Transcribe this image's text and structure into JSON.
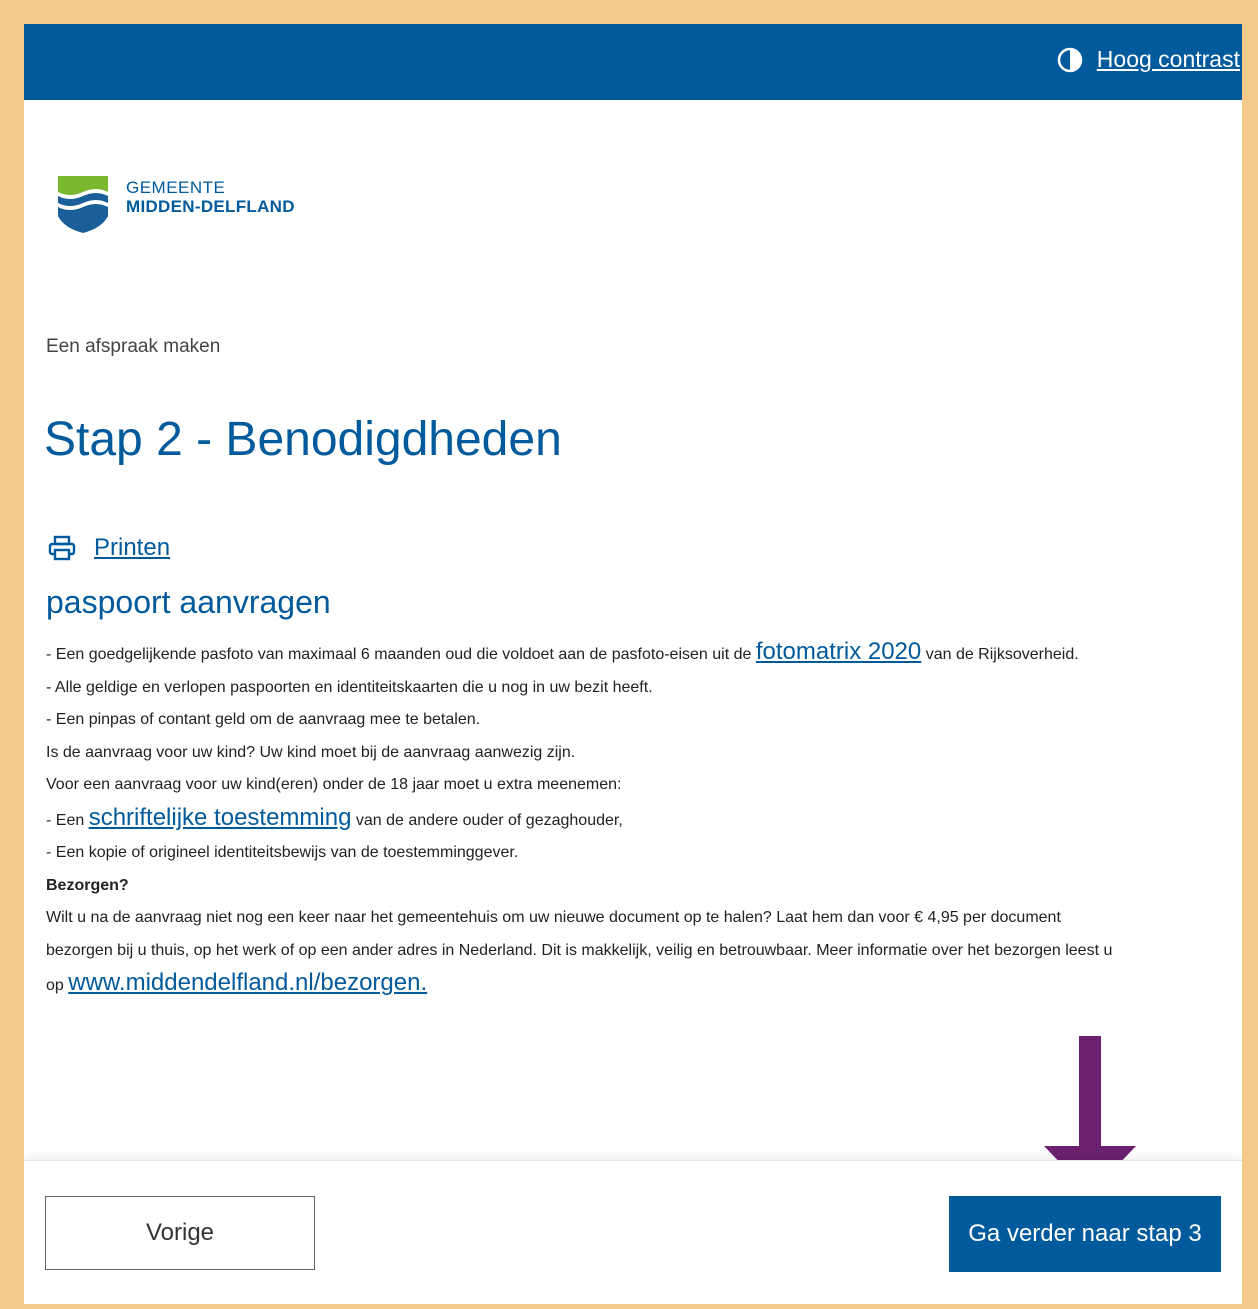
{
  "header": {
    "contrast_label": "Hoog contrast"
  },
  "logo": {
    "line1": "GEMEENTE",
    "line2": "MIDDEN-DELFLAND"
  },
  "breadcrumb": "Een afspraak maken",
  "title": "Stap 2 - Benodigdheden",
  "print_label": "Printen",
  "subtitle": "paspoort aanvragen",
  "content": {
    "line1_pre": "- Een goedgelijkende pasfoto van maximaal 6 maanden oud die voldoet aan de pasfoto-eisen uit de ",
    "line1_link": "fotomatrix 2020",
    "line1_post": " van de Rijksoverheid.",
    "line2": "- Alle geldige en verlopen paspoorten en identiteitskaarten die u nog in uw bezit heeft.",
    "line3": "- Een pinpas of contant geld om de aanvraag mee te betalen.",
    "line4": "Is de aanvraag voor uw kind? Uw kind moet bij de aanvraag aanwezig zijn.",
    "line5": "Voor een aanvraag voor uw kind(eren) onder de 18 jaar moet u extra meenemen:",
    "line6_pre": "- Een ",
    "line6_link": "schriftelijke toestemming",
    "line6_post": " van de andere ouder of gezaghouder,",
    "line7": "- Een kopie of origineel identiteitsbewijs van de toestemminggever.",
    "bezorgen_heading": "Bezorgen?",
    "bezorgen_text1": "Wilt u na de aanvraag niet nog een keer naar het gemeentehuis om uw nieuwe document op te halen? Laat hem dan voor € 4,95 per document",
    "bezorgen_text2": "bezorgen bij u thuis, op het werk of op een ander adres in Nederland. Dit is makkelijk, veilig en betrouwbaar. Meer informatie over het bezorgen leest u",
    "bezorgen_pre": "op ",
    "bezorgen_link": "www.middendelfland.nl/bezorgen."
  },
  "footer": {
    "prev_label": "Vorige",
    "next_label": "Ga verder naar stap 3"
  },
  "colors": {
    "brand_blue": "#005a9c",
    "frame": "#f5c98a",
    "arrow": "#6b2070"
  }
}
